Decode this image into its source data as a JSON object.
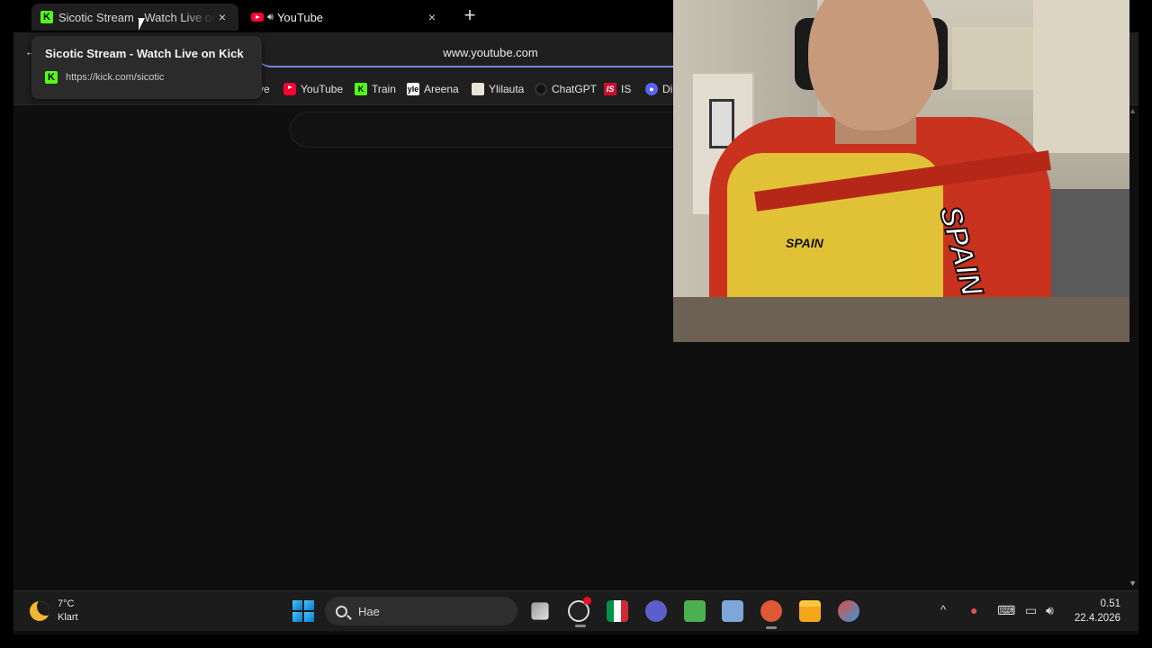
{
  "browser": {
    "tabs": [
      {
        "title": "Sicotic Stream - Watch Live on Kick",
        "favicon": "kick-icon"
      },
      {
        "title": "YouTube",
        "favicon": "youtube-icon",
        "audio": true
      }
    ],
    "new_tab_symbol": "+",
    "close_symbol": "×",
    "address": "www.youtube.com",
    "bookmarks": [
      {
        "label": "ve",
        "icon": "none"
      },
      {
        "label": "YouTube",
        "icon": "youtube-icon"
      },
      {
        "label": "Train",
        "icon": "kick-icon"
      },
      {
        "label": "Areena",
        "icon": "yle-icon"
      },
      {
        "label": "Ylilauta",
        "icon": "ylilauta-icon"
      },
      {
        "label": "ChatGPT",
        "icon": "chatgpt-icon"
      },
      {
        "label": "IS",
        "icon": "is-icon"
      },
      {
        "label": "Di",
        "icon": "discord-icon"
      }
    ]
  },
  "tooltip": {
    "title": "Sicotic Stream - Watch Live on Kick",
    "url": "https://kick.com/sicotic"
  },
  "webcam": {
    "shirt_text_left": "SPAIN",
    "shirt_text_right": "SPAIN"
  },
  "taskbar": {
    "weather_temp": "7°C",
    "weather_condition": "Klart",
    "search_placeholder": "Hae",
    "time": "0.51",
    "date": "22.4.2026"
  },
  "colors": {
    "kick_green": "#53fc18",
    "youtube_red": "#ff0033",
    "address_underline": "#7b86d8"
  }
}
